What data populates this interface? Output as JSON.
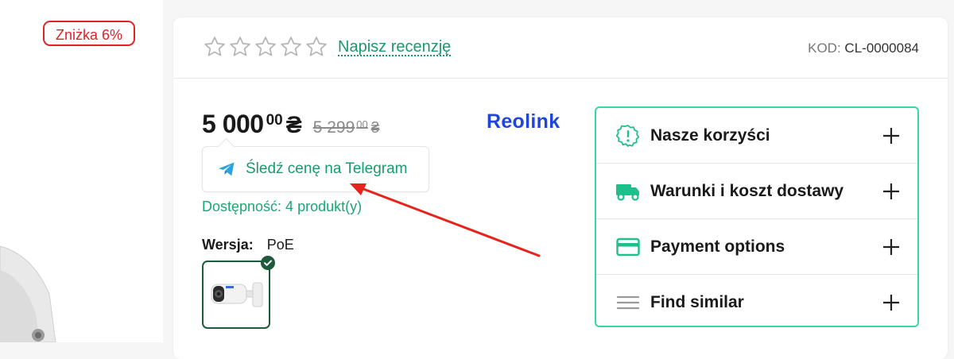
{
  "badge": {
    "discount": "Zniżka 6%"
  },
  "rating": {
    "stars_filled": 0,
    "stars_total": 5,
    "review_link": "Napisz recenzję"
  },
  "product_code": {
    "label": "KOD:",
    "value": "CL-0000084"
  },
  "price": {
    "current_main": "5 000",
    "current_cents": "00",
    "currency": "₴",
    "old_main": "5 299",
    "old_cents": "00",
    "old_currency": "₴"
  },
  "brand": {
    "name": "Reolink"
  },
  "telegram": {
    "label": "Śledź cenę na Telegram",
    "icon": "telegram-plane-icon"
  },
  "availability": "Dostępność: 4 produkt(y)",
  "version": {
    "label": "Wersja:",
    "value": "PoE"
  },
  "accordion": {
    "items": [
      {
        "label": "Nasze korzyści",
        "icon": "badge-alert-icon"
      },
      {
        "label": "Warunki i koszt dostawy",
        "icon": "truck-icon"
      },
      {
        "label": "Payment options",
        "icon": "credit-card-icon"
      },
      {
        "label": "Find similar",
        "icon": "list-lines-icon"
      }
    ]
  },
  "colors": {
    "accent_green": "#1a9a6a",
    "border_green": "#3ad6a6",
    "badge_red": "#e0222a",
    "brand_blue": "#1f46d8",
    "arrow_red": "#e8221c"
  }
}
